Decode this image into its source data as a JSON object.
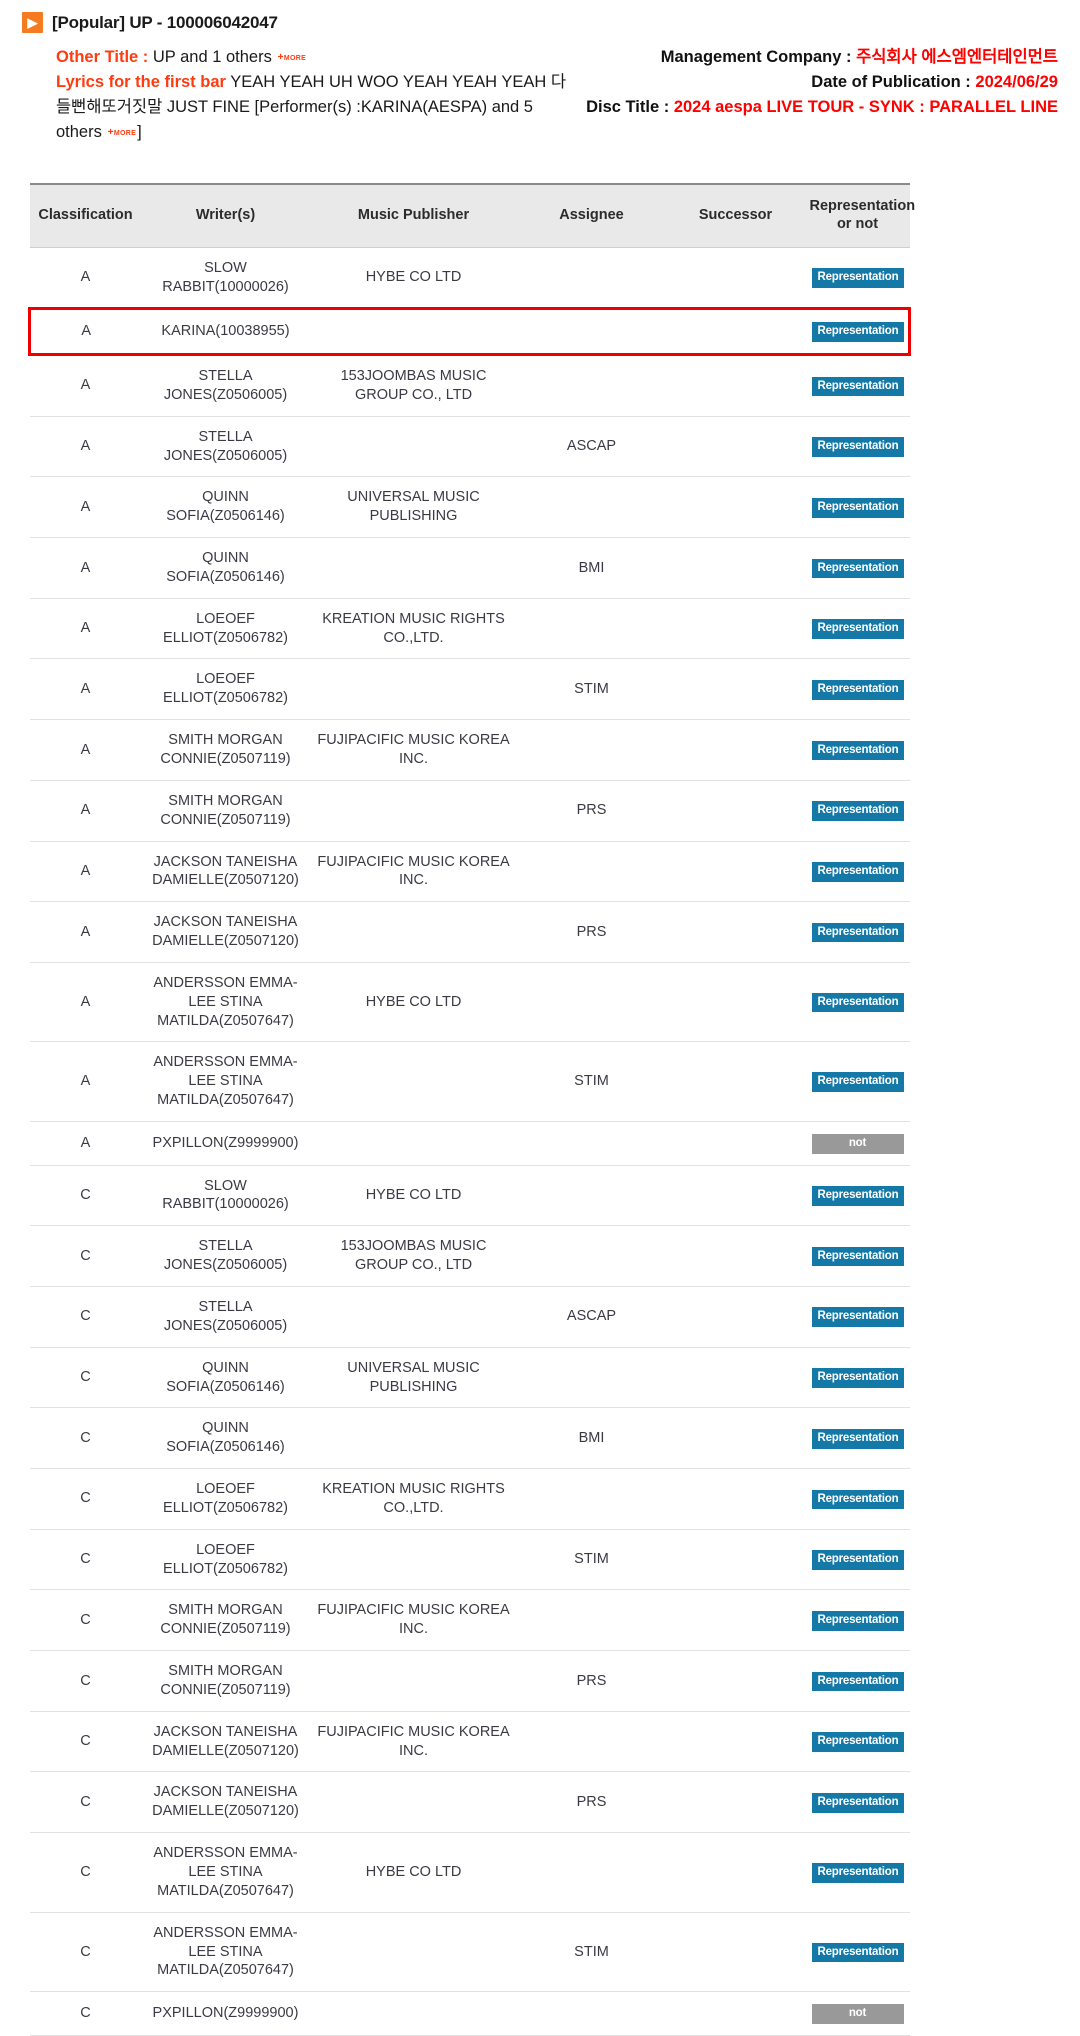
{
  "header": {
    "arrow_icon": "chevron-right-icon",
    "title": "[Popular] UP - 100006042047",
    "other_title_label": "Other Title :",
    "other_title_value": "UP and 1 others",
    "other_title_more": "+more",
    "lyrics_label": "Lyrics for the first bar",
    "lyrics_value": "YEAH YEAH UH WOO YEAH YEAH YEAH 다들뻔해또거짓말 JUST FINE [Performer(s) :KARINA(AESPA) and 5 others",
    "lyrics_more": "+more",
    "lyrics_close_bracket": "]",
    "management_company_label": "Management Company :",
    "management_company_value": "주식회사 에스엠엔터테인먼트",
    "date_of_publication_label": "Date of Publication :",
    "date_of_publication_value": "2024/06/29",
    "disc_title_label": "Disc Title :",
    "disc_title_value": "2024 aespa LIVE TOUR - SYNK : PARALLEL LINE"
  },
  "colors": {
    "accent_orange": "#f47b20",
    "label_red": "#ff3b10",
    "value_red": "#ff0000",
    "badge_rep": "#1579a8",
    "badge_not": "#999999",
    "highlight_border": "#ee0000",
    "header_bg": "#e9e9e9"
  },
  "table": {
    "columns": [
      "Classification",
      "Writer(s)",
      "Music Publisher",
      "Assignee",
      "Successor",
      "Representation or not"
    ],
    "badge_labels": {
      "representation": "Representation",
      "not": "not"
    },
    "rows": [
      {
        "classification": "A",
        "writer": "SLOW RABBIT(10000026)",
        "publisher": "HYBE CO LTD",
        "assignee": "",
        "successor": "",
        "representation": "Representation",
        "highlight": false
      },
      {
        "classification": "A",
        "writer": "KARINA(10038955)",
        "publisher": "",
        "assignee": "",
        "successor": "",
        "representation": "Representation",
        "highlight": true
      },
      {
        "classification": "A",
        "writer": "STELLA JONES(Z0506005)",
        "publisher": "153JOOMBAS MUSIC GROUP CO., LTD",
        "assignee": "",
        "successor": "",
        "representation": "Representation",
        "highlight": false
      },
      {
        "classification": "A",
        "writer": "STELLA JONES(Z0506005)",
        "publisher": "",
        "assignee": "ASCAP",
        "successor": "",
        "representation": "Representation",
        "highlight": false
      },
      {
        "classification": "A",
        "writer": "QUINN SOFIA(Z0506146)",
        "publisher": "UNIVERSAL MUSIC PUBLISHING",
        "assignee": "",
        "successor": "",
        "representation": "Representation",
        "highlight": false
      },
      {
        "classification": "A",
        "writer": "QUINN SOFIA(Z0506146)",
        "publisher": "",
        "assignee": "BMI",
        "successor": "",
        "representation": "Representation",
        "highlight": false
      },
      {
        "classification": "A",
        "writer": "LOEOEF ELLIOT(Z0506782)",
        "publisher": "KREATION MUSIC RIGHTS CO.,LTD.",
        "assignee": "",
        "successor": "",
        "representation": "Representation",
        "highlight": false
      },
      {
        "classification": "A",
        "writer": "LOEOEF ELLIOT(Z0506782)",
        "publisher": "",
        "assignee": "STIM",
        "successor": "",
        "representation": "Representation",
        "highlight": false
      },
      {
        "classification": "A",
        "writer": "SMITH MORGAN CONNIE(Z0507119)",
        "publisher": "FUJIPACIFIC MUSIC KOREA INC.",
        "assignee": "",
        "successor": "",
        "representation": "Representation",
        "highlight": false
      },
      {
        "classification": "A",
        "writer": "SMITH MORGAN CONNIE(Z0507119)",
        "publisher": "",
        "assignee": "PRS",
        "successor": "",
        "representation": "Representation",
        "highlight": false
      },
      {
        "classification": "A",
        "writer": "JACKSON TANEISHA DAMIELLE(Z0507120)",
        "publisher": "FUJIPACIFIC MUSIC KOREA INC.",
        "assignee": "",
        "successor": "",
        "representation": "Representation",
        "highlight": false
      },
      {
        "classification": "A",
        "writer": "JACKSON TANEISHA DAMIELLE(Z0507120)",
        "publisher": "",
        "assignee": "PRS",
        "successor": "",
        "representation": "Representation",
        "highlight": false
      },
      {
        "classification": "A",
        "writer": "ANDERSSON EMMA-LEE STINA MATILDA(Z0507647)",
        "publisher": "HYBE CO LTD",
        "assignee": "",
        "successor": "",
        "representation": "Representation",
        "highlight": false
      },
      {
        "classification": "A",
        "writer": "ANDERSSON EMMA-LEE STINA MATILDA(Z0507647)",
        "publisher": "",
        "assignee": "STIM",
        "successor": "",
        "representation": "Representation",
        "highlight": false
      },
      {
        "classification": "A",
        "writer": "PXPILLON(Z9999900)",
        "publisher": "",
        "assignee": "",
        "successor": "",
        "representation": "not",
        "highlight": false
      },
      {
        "classification": "C",
        "writer": "SLOW RABBIT(10000026)",
        "publisher": "HYBE CO LTD",
        "assignee": "",
        "successor": "",
        "representation": "Representation",
        "highlight": false
      },
      {
        "classification": "C",
        "writer": "STELLA JONES(Z0506005)",
        "publisher": "153JOOMBAS MUSIC GROUP CO., LTD",
        "assignee": "",
        "successor": "",
        "representation": "Representation",
        "highlight": false
      },
      {
        "classification": "C",
        "writer": "STELLA JONES(Z0506005)",
        "publisher": "",
        "assignee": "ASCAP",
        "successor": "",
        "representation": "Representation",
        "highlight": false
      },
      {
        "classification": "C",
        "writer": "QUINN SOFIA(Z0506146)",
        "publisher": "UNIVERSAL MUSIC PUBLISHING",
        "assignee": "",
        "successor": "",
        "representation": "Representation",
        "highlight": false
      },
      {
        "classification": "C",
        "writer": "QUINN SOFIA(Z0506146)",
        "publisher": "",
        "assignee": "BMI",
        "successor": "",
        "representation": "Representation",
        "highlight": false
      },
      {
        "classification": "C",
        "writer": "LOEOEF ELLIOT(Z0506782)",
        "publisher": "KREATION MUSIC RIGHTS CO.,LTD.",
        "assignee": "",
        "successor": "",
        "representation": "Representation",
        "highlight": false
      },
      {
        "classification": "C",
        "writer": "LOEOEF ELLIOT(Z0506782)",
        "publisher": "",
        "assignee": "STIM",
        "successor": "",
        "representation": "Representation",
        "highlight": false
      },
      {
        "classification": "C",
        "writer": "SMITH MORGAN CONNIE(Z0507119)",
        "publisher": "FUJIPACIFIC MUSIC KOREA INC.",
        "assignee": "",
        "successor": "",
        "representation": "Representation",
        "highlight": false
      },
      {
        "classification": "C",
        "writer": "SMITH MORGAN CONNIE(Z0507119)",
        "publisher": "",
        "assignee": "PRS",
        "successor": "",
        "representation": "Representation",
        "highlight": false
      },
      {
        "classification": "C",
        "writer": "JACKSON TANEISHA DAMIELLE(Z0507120)",
        "publisher": "FUJIPACIFIC MUSIC KOREA INC.",
        "assignee": "",
        "successor": "",
        "representation": "Representation",
        "highlight": false
      },
      {
        "classification": "C",
        "writer": "JACKSON TANEISHA DAMIELLE(Z0507120)",
        "publisher": "",
        "assignee": "PRS",
        "successor": "",
        "representation": "Representation",
        "highlight": false
      },
      {
        "classification": "C",
        "writer": "ANDERSSON EMMA-LEE STINA MATILDA(Z0507647)",
        "publisher": "HYBE CO LTD",
        "assignee": "",
        "successor": "",
        "representation": "Representation",
        "highlight": false
      },
      {
        "classification": "C",
        "writer": "ANDERSSON EMMA-LEE STINA MATILDA(Z0507647)",
        "publisher": "",
        "assignee": "STIM",
        "successor": "",
        "representation": "Representation",
        "highlight": false
      },
      {
        "classification": "C",
        "writer": "PXPILLON(Z9999900)",
        "publisher": "",
        "assignee": "",
        "successor": "",
        "representation": "not",
        "highlight": false
      }
    ]
  }
}
